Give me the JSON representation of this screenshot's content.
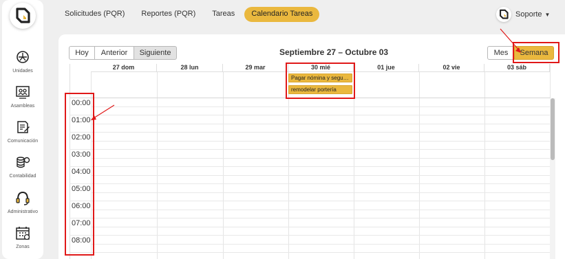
{
  "sidebar": {
    "items": [
      {
        "label": "Unidades",
        "icon": "unidades-icon"
      },
      {
        "label": "Asambleas",
        "icon": "asambleas-icon"
      },
      {
        "label": "Comunicación",
        "icon": "comunicacion-icon"
      },
      {
        "label": "Contabilidad",
        "icon": "contabilidad-icon"
      },
      {
        "label": "Administrativo",
        "icon": "administrativo-icon"
      },
      {
        "label": "Zonas",
        "icon": "zonas-icon"
      }
    ]
  },
  "topnav": {
    "tabs": [
      {
        "label": "Solicitudes (PQR)",
        "active": false
      },
      {
        "label": "Reportes (PQR)",
        "active": false
      },
      {
        "label": "Tareas",
        "active": false
      },
      {
        "label": "Calendario Tareas",
        "active": true
      }
    ]
  },
  "user": {
    "name": "Soporte"
  },
  "calendar": {
    "nav": {
      "today": "Hoy",
      "prev": "Anterior",
      "next": "Siguiente"
    },
    "title": "Septiembre 27 – Octubre 03",
    "views": {
      "month": "Mes",
      "week": "Semana"
    },
    "days": [
      "27 dom",
      "28 lun",
      "29 mar",
      "30 mié",
      "01 jue",
      "02 vie",
      "03 sáb"
    ],
    "hours": [
      "00:00",
      "01:00",
      "02:00",
      "03:00",
      "04:00",
      "05:00",
      "06:00",
      "07:00",
      "08:00"
    ],
    "events": [
      {
        "title": "Pagar nómina y seguridad social",
        "day": "30 mié"
      },
      {
        "title": "remodelar portería",
        "day": "30 mié"
      }
    ]
  },
  "colors": {
    "accent": "#eab83e",
    "highlight": "#e01818"
  }
}
